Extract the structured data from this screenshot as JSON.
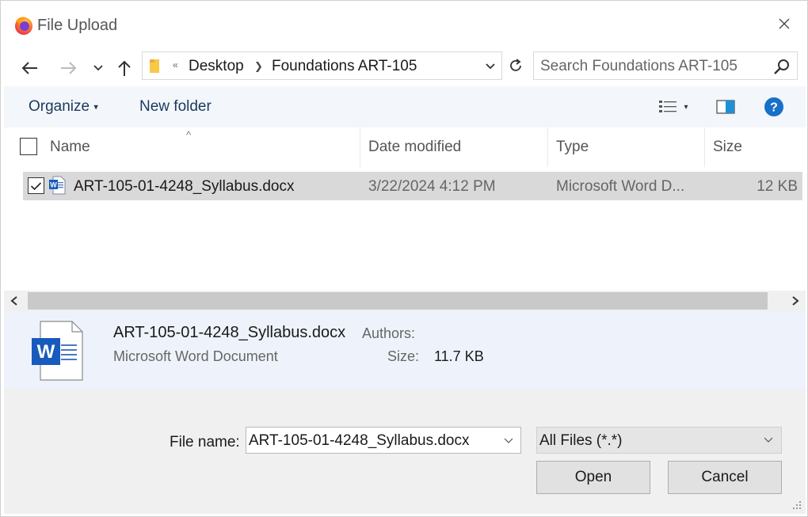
{
  "window": {
    "title": "File Upload",
    "app_icon": "firefox-icon"
  },
  "nav": {
    "breadcrumbs": [
      "Desktop",
      "Foundations ART-105"
    ],
    "overflow_glyph": "«",
    "search_placeholder": "Search Foundations ART-105"
  },
  "toolbar": {
    "organize_label": "Organize",
    "organize_caret": "▾",
    "new_folder_label": "New folder"
  },
  "columns": {
    "name": "Name",
    "date_modified": "Date modified",
    "type": "Type",
    "size": "Size"
  },
  "files": [
    {
      "name": "ART-105-01-4248_Syllabus.docx",
      "date_modified": "3/22/2024 4:12 PM",
      "type": "Microsoft Word D...",
      "size": "12 KB",
      "checked": true
    }
  ],
  "details": {
    "name": "ART-105-01-4248_Syllabus.docx",
    "authors_label": "Authors:",
    "type": "Microsoft Word Document",
    "size_label": "Size:",
    "size_value": "11.7 KB"
  },
  "footer": {
    "file_name_label": "File name:",
    "file_name_value": "ART-105-01-4248_Syllabus.docx",
    "file_type_value": "All Files (*.*)",
    "open_label": "Open",
    "cancel_label": "Cancel"
  },
  "colors": {
    "accent": "#0067c0",
    "word_blue": "#185abd",
    "toolbar_bg": "#f3f6fb",
    "selection": "#d9d9d9"
  }
}
